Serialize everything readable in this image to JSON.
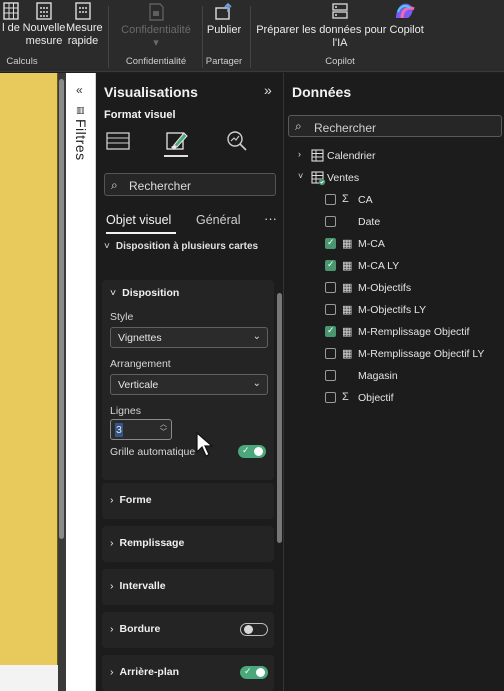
{
  "ribbon": {
    "buttons": [
      {
        "label_line1": "l de",
        "label_line2": ""
      },
      {
        "label_line1": "Nouvelle",
        "label_line2": "mesure"
      },
      {
        "label_line1": "Mesure",
        "label_line2": "rapide"
      },
      {
        "label_line1": "Confidentialité",
        "label_line2": "▾"
      },
      {
        "label_line1": "Publier",
        "label_line2": ""
      },
      {
        "label_line1": "Préparer les données pour Copilot",
        "label_line2": "l'IA"
      }
    ],
    "groups": [
      "Calculs",
      "Confidentialité",
      "Partager",
      "Copilot"
    ]
  },
  "filters": {
    "label": "Filtres",
    "collapse_glyph": "«"
  },
  "visualisations": {
    "title": "Visualisations",
    "expand_glyph": "»",
    "format_label": "Format visuel",
    "search_placeholder": "Rechercher",
    "tabs": [
      "Objet visuel",
      "Général"
    ],
    "more_glyph": "···",
    "multi_card_title": "Disposition à plusieurs cartes",
    "disposition": {
      "title": "Disposition",
      "style_label": "Style",
      "style_value": "Vignettes",
      "arrangement_label": "Arrangement",
      "arrangement_value": "Verticale",
      "lignes_label": "Lignes",
      "lignes_value": "3",
      "grille_label": "Grille automatique",
      "grille_on": true
    },
    "sections": [
      {
        "title": "Forme"
      },
      {
        "title": "Remplissage"
      },
      {
        "title": "Intervalle"
      },
      {
        "title": "Bordure",
        "toggle": "off"
      },
      {
        "title": "Arrière-plan",
        "toggle": "on"
      }
    ]
  },
  "data": {
    "title": "Données",
    "search_placeholder": "Rechercher",
    "tables": [
      {
        "name": "Calendrier",
        "expanded": false
      },
      {
        "name": "Ventes",
        "expanded": true
      }
    ],
    "fields": [
      {
        "name": "CA",
        "icon": "sigma-icon",
        "checked": false
      },
      {
        "name": "Date",
        "icon": "",
        "checked": false
      },
      {
        "name": "M-CA",
        "icon": "measure-icon",
        "checked": true
      },
      {
        "name": "M-CA LY",
        "icon": "measure-icon",
        "checked": true
      },
      {
        "name": "M-Objectifs",
        "icon": "measure-icon",
        "checked": false
      },
      {
        "name": "M-Objectifs LY",
        "icon": "measure-icon",
        "checked": false
      },
      {
        "name": "M-Remplissage Objectif",
        "icon": "measure-icon",
        "checked": true
      },
      {
        "name": "M-Remplissage Objectif LY",
        "icon": "measure-icon",
        "checked": false
      },
      {
        "name": "Magasin",
        "icon": "",
        "checked": false
      },
      {
        "name": "Objectif",
        "icon": "sigma-icon",
        "checked": false
      }
    ]
  },
  "colors": {
    "canvas_visual": "#e8c95c",
    "toggle_on": "#4aa87a",
    "checkbox_on": "#4a9670",
    "pane_bg": "#1c1c1c"
  }
}
